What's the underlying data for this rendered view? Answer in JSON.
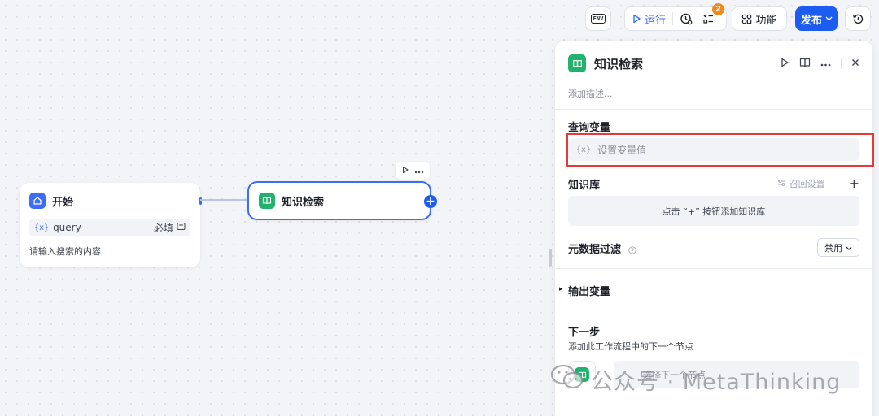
{
  "toolbar": {
    "env_label": "ENV",
    "run_label": "运行",
    "checklist_badge": "2",
    "features_label": "功能",
    "publish_label": "发布"
  },
  "canvas": {
    "start_node": {
      "title": "开始",
      "variable_tag": "{x}",
      "variable_name": "query",
      "required_label": "必填",
      "description": "请输入搜索的内容"
    },
    "ks_node": {
      "title": "知识检索"
    }
  },
  "panel": {
    "title": "知识检索",
    "description_placeholder": "添加描述...",
    "query_section": {
      "title": "查询变量",
      "var_tag": "{x}",
      "input_placeholder": "设置变量值"
    },
    "knowledge_section": {
      "title": "知识库",
      "recall_settings": "召回设置",
      "add": "+",
      "empty_hint": "点击 “+” 按钮添加知识库"
    },
    "metadata_section": {
      "title": "元数据过滤",
      "select_value": "禁用"
    },
    "output_section": {
      "title": "输出变量"
    },
    "next_section": {
      "title": "下一步",
      "description": "添加此工作流程中的下一个节点",
      "select_placeholder": "选择下一个节点"
    }
  },
  "watermark": {
    "text": "公众号 · MetaThinking"
  },
  "colors": {
    "accent": "#1d5cf0",
    "knowledge_green": "#23b26d",
    "highlight_red": "#e33b3b",
    "badge_orange": "#f08a1c"
  }
}
